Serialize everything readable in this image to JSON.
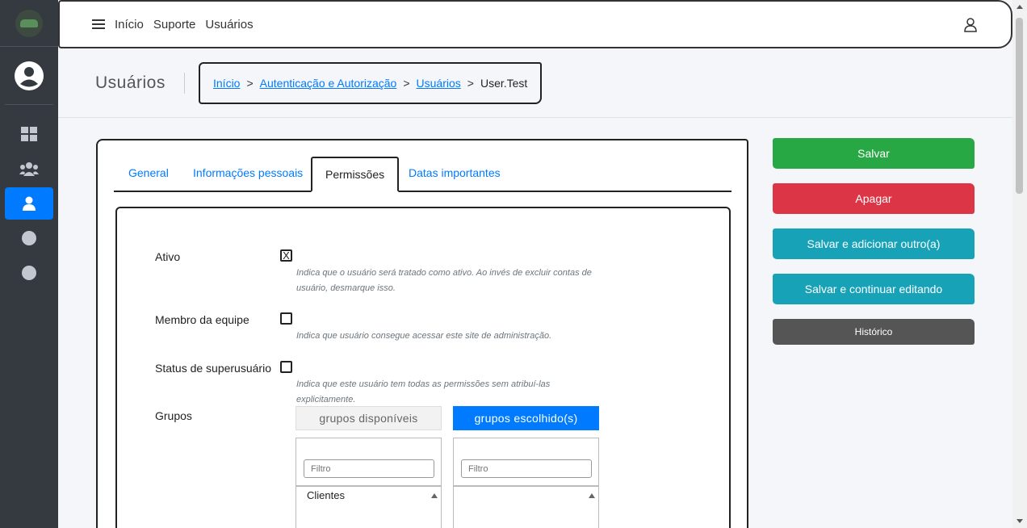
{
  "topbar": {
    "menu_icon": "hamburger-icon",
    "links": [
      "Início",
      "Suporte",
      "Usuários"
    ],
    "user_icon": "user-outline-icon"
  },
  "sidebar": {
    "logo_icon": "car-logo-icon",
    "avatar_icon": "user-circle-icon",
    "items": [
      {
        "icon": "dashboard-grid-icon",
        "active": false
      },
      {
        "icon": "users-group-icon",
        "active": false
      },
      {
        "icon": "user-icon",
        "active": true
      },
      {
        "icon": "circle-icon",
        "active": false
      },
      {
        "icon": "circle-icon",
        "active": false
      }
    ]
  },
  "header": {
    "title": "Usuários",
    "breadcrumb": {
      "home": "Início",
      "sep": ">",
      "section": "Autenticação e Autorização",
      "model": "Usuários",
      "current": "User.Test"
    }
  },
  "tabs": [
    "General",
    "Informações pessoais",
    "Permissões",
    "Datas importantes"
  ],
  "active_tab": "Permissões",
  "form": {
    "ativo": {
      "label": "Ativo",
      "checked": true,
      "check_mark": "X",
      "help": "Indica que o usuário será tratado como ativo. Ao invés de excluir contas de usuário, desmarque isso."
    },
    "staff": {
      "label": "Membro da equipe",
      "checked": false,
      "help": "Indica que usuário consegue acessar este site de administração."
    },
    "superuser": {
      "label": "Status de superusuário",
      "checked": false,
      "help": "Indica que este usuário tem todas as permissões sem atribuí-las explicitamente."
    },
    "grupos": {
      "label": "Grupos",
      "available_title": "grupos disponíveis",
      "chosen_title": "grupos escolhido(s)",
      "filter_placeholder": "Filtro",
      "available_items": [
        "Clientes"
      ],
      "chosen_items": []
    }
  },
  "actions": {
    "save": "Salvar",
    "delete": "Apagar",
    "save_add": "Salvar e adicionar outro(a)",
    "save_continue": "Salvar e continuar editando",
    "history": "Histórico"
  },
  "colors": {
    "sidebar_bg": "#343a40",
    "primary": "#007bff",
    "success": "#28a745",
    "danger": "#dc3545",
    "info": "#17a2b8",
    "secondary_dark": "#555555"
  }
}
